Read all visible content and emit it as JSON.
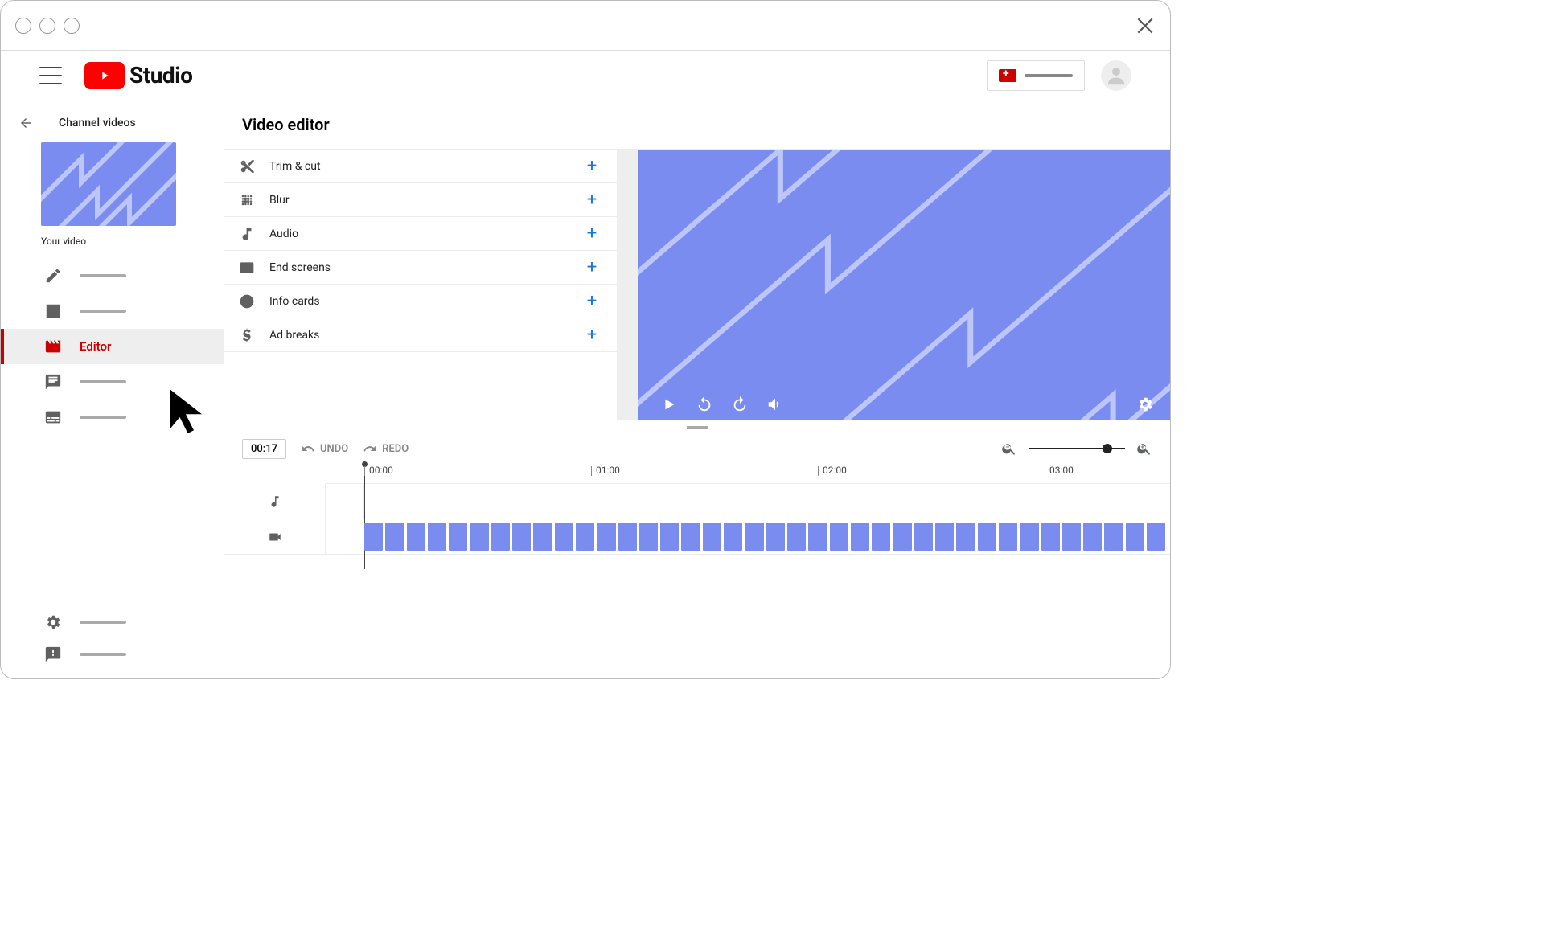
{
  "brand": {
    "name": "Studio"
  },
  "sidebar": {
    "back_label": "Channel videos",
    "your_video_label": "Your video",
    "items": [
      {
        "icon": "pencil",
        "label": ""
      },
      {
        "icon": "analytics",
        "label": ""
      },
      {
        "icon": "editor",
        "label": "Editor"
      },
      {
        "icon": "comments",
        "label": ""
      },
      {
        "icon": "subtitles",
        "label": ""
      }
    ],
    "footer": [
      {
        "icon": "settings",
        "label": ""
      },
      {
        "icon": "feedback",
        "label": ""
      }
    ]
  },
  "main": {
    "title": "Video editor",
    "tools": [
      {
        "icon": "cut",
        "label": "Trim & cut"
      },
      {
        "icon": "blur",
        "label": "Blur"
      },
      {
        "icon": "note",
        "label": "Audio"
      },
      {
        "icon": "endscreen",
        "label": "End screens"
      },
      {
        "icon": "info",
        "label": "Info cards"
      },
      {
        "icon": "dollar",
        "label": "Ad breaks"
      }
    ]
  },
  "timeline": {
    "current_time": "00:17",
    "undo_label": "UNDO",
    "redo_label": "REDO",
    "ticks": [
      "00:00",
      "01:00",
      "02:00",
      "03:00"
    ]
  }
}
